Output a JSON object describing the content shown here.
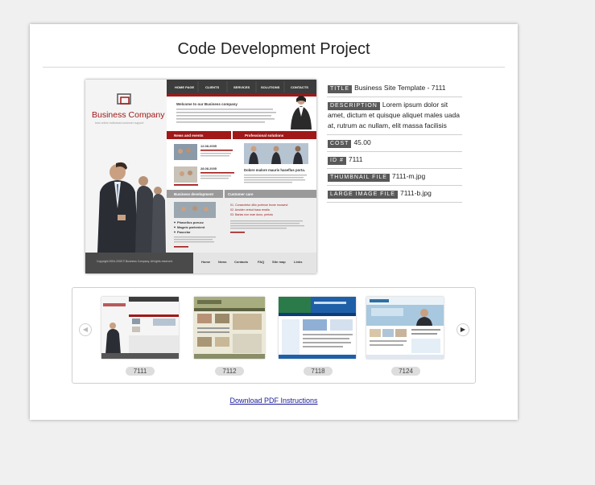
{
  "page": {
    "title": "Code Development Project"
  },
  "preview": {
    "brand": "Business Company",
    "tagline": "best online individual customer support",
    "nav": [
      "HOME PAGE",
      "CLIENTS",
      "SERVICES",
      "SOLUTIONS",
      "CONTACTS"
    ],
    "welcome_title": "Welcome to our Business company",
    "sections": [
      "News and events",
      "Professional solutions",
      "Business development",
      "Customer care"
    ],
    "news_dates": [
      "12.08.2005",
      "28.08.2005"
    ],
    "solution_heading": "Dolore malore mauris haseflus porta.",
    "bullets": [
      "Phasellus porucz",
      "Magnis partenient",
      "Pascelar"
    ],
    "care_links": [
      "01. Consectetur dilio portmoe leone mouwnd",
      "02. Ansider vertud basa reralia",
      "03. Barlas non mae duno, pertolu"
    ],
    "footer_links": [
      "Home",
      "News",
      "Contacts",
      "FAQ",
      "Site map",
      "Links"
    ],
    "copyright": "Copyright 2004-2005 © Business Company. All rights reserved."
  },
  "details": {
    "title": {
      "label": "TITLE",
      "value": "Business Site Template - 7111"
    },
    "description": {
      "label": "DESCRIPTION",
      "value": "Lorem ipsum dolor sit amet, dictum et quisque aliquet males uada at, rutrum ac nullam, elit massa facilisis"
    },
    "cost": {
      "label": "COST",
      "value": "45.00"
    },
    "id": {
      "label": "ID #",
      "value": "7111"
    },
    "thumbnail": {
      "label": "THUMBNAIL FILE",
      "value": "7111-m.jpg"
    },
    "large_image": {
      "label": "LARGE IMAGE FILE",
      "value": "7111-b.jpg"
    }
  },
  "carousel": {
    "prev_icon": "chevron-left-icon",
    "next_icon": "chevron-right-icon",
    "items": [
      {
        "label": "7111"
      },
      {
        "label": "7112"
      },
      {
        "label": "7118"
      },
      {
        "label": "7124"
      }
    ]
  },
  "download": {
    "label": "Download PDF Instructions"
  },
  "colors": {
    "accent_red": "#a01818",
    "label_gray": "#595959",
    "nav_dark": "#2c2c2c",
    "link_blue": "#1a1a9a"
  }
}
